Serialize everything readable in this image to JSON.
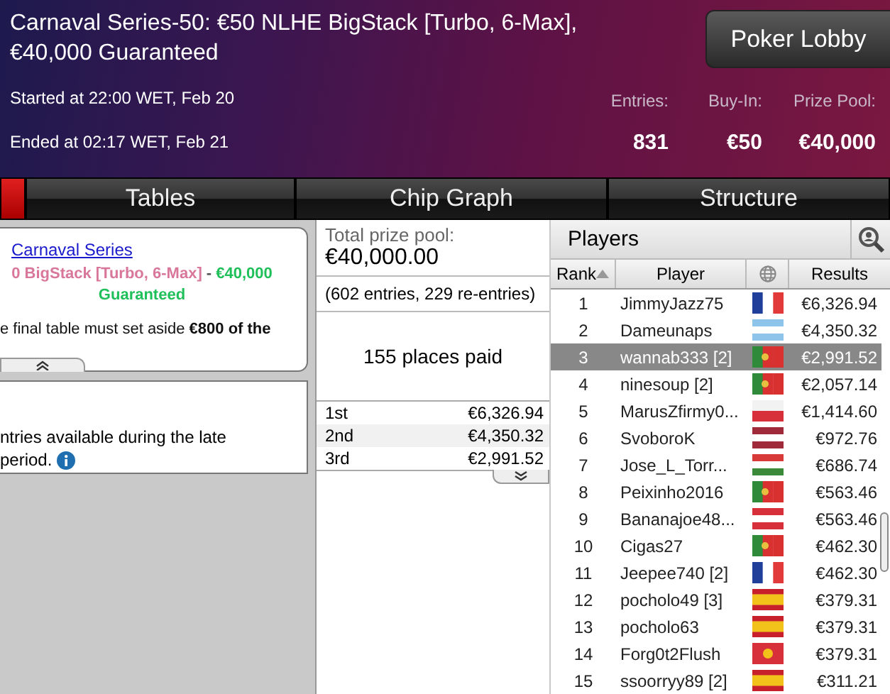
{
  "header": {
    "title": "Carnaval Series-50: €50 NLHE BigStack [Turbo, 6-Max], €40,000 Guaranteed",
    "started": "Started at 22:00 WET, Feb 20",
    "ended": "Ended at 02:17 WET, Feb 21",
    "lobby_button": "Poker Lobby",
    "stats": [
      {
        "label": "Entries:",
        "value": "831"
      },
      {
        "label": "Buy-In:",
        "value": "€50"
      },
      {
        "label": "Prize Pool:",
        "value": "€40,000"
      }
    ]
  },
  "tabs": [
    {
      "selected": true
    },
    {
      "label": "Tables",
      "selected": false
    },
    {
      "label": "Chip Graph",
      "selected": false
    },
    {
      "label": "Structure",
      "selected": false
    }
  ],
  "info_card": {
    "series_link": "Carnaval Series",
    "event_name": "0 BigStack [Turbo, 6-Max]",
    "separator": " - ",
    "prize": "€40,000",
    "guarantee": "Guaranteed",
    "note": "e final table must set aside **€800 of the**"
  },
  "reentry_card": {
    "text_lines": [
      "ntries available during the late",
      "period."
    ]
  },
  "prize_panel": {
    "total_label": "Total prize pool:",
    "total": "€40,000.00",
    "entries": "(602 entries, 229 re-entries)",
    "places_paid": "155 places paid",
    "payouts": [
      {
        "place": "1st",
        "amount": "€6,326.94"
      },
      {
        "place": "2nd",
        "amount": "€4,350.32"
      },
      {
        "place": "3rd",
        "amount": "€2,991.52"
      }
    ]
  },
  "players": {
    "title": "Players",
    "columns": [
      "Rank",
      "Player",
      "Results"
    ],
    "rows": [
      {
        "rank": "1",
        "player": "JimmyJazz75",
        "kind": "fr",
        "result": "€6,326.94",
        "selected": false
      },
      {
        "rank": "2",
        "player": "Dameunaps",
        "kind": "ar",
        "result": "€4,350.32",
        "selected": false
      },
      {
        "rank": "3",
        "player": "wannab333 [2]",
        "kind": "pt",
        "result": "€2,991.52",
        "selected": true
      },
      {
        "rank": "4",
        "player": "ninesoup [2]",
        "kind": "pt",
        "result": "€2,057.14",
        "selected": false
      },
      {
        "rank": "5",
        "player": "MarusZfirmy0...",
        "kind": "pl",
        "result": "€1,414.60",
        "selected": false
      },
      {
        "rank": "6",
        "player": "SvoboroK",
        "kind": "lv",
        "result": "€972.76",
        "selected": false
      },
      {
        "rank": "7",
        "player": "Jose_L_Torr...",
        "kind": "hu",
        "result": "€686.74",
        "selected": false
      },
      {
        "rank": "8",
        "player": "Peixinho2016",
        "kind": "pt",
        "result": "€563.46",
        "selected": false
      },
      {
        "rank": "9",
        "player": "Bananajoe48...",
        "kind": "at",
        "result": "€563.46",
        "selected": false
      },
      {
        "rank": "10",
        "player": "Cigas27",
        "kind": "pt",
        "result": "€462.30",
        "selected": false
      },
      {
        "rank": "11",
        "player": "Jeepee740 [2]",
        "kind": "fr",
        "result": "€462.30",
        "selected": false
      },
      {
        "rank": "12",
        "player": "pocholo49 [3]",
        "kind": "es",
        "result": "€379.31",
        "selected": false
      },
      {
        "rank": "13",
        "player": "pocholo63",
        "kind": "es",
        "result": "€379.31",
        "selected": false
      },
      {
        "rank": "14",
        "player": "Forg0t2Flush",
        "kind": "kg",
        "result": "€379.31",
        "selected": false
      },
      {
        "rank": "15",
        "player": "ssoorryy89 [2]",
        "kind": "es",
        "result": "€311.21",
        "selected": false
      }
    ]
  }
}
